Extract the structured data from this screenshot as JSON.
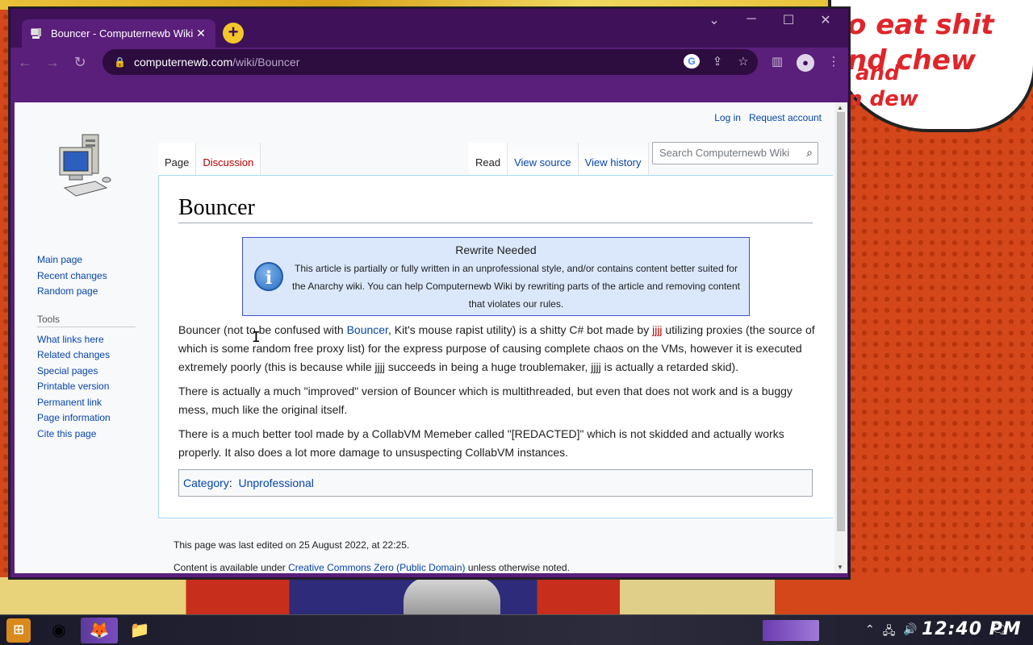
{
  "desktop": {
    "bubble_lines": [
      "o eat shit",
      "nd chew",
      "and",
      "n dew"
    ]
  },
  "browser": {
    "tab_title": "Bouncer - Computernewb Wiki",
    "new_tab_symbol": "+",
    "url_host": "computernewb.com",
    "url_path": "/wiki/Bouncer",
    "accent_color": "#5a1f7a"
  },
  "wiki": {
    "personal": {
      "login": "Log in",
      "request_account": "Request account"
    },
    "nav": [
      "Main page",
      "Recent changes",
      "Random page"
    ],
    "tools_heading": "Tools",
    "tools": [
      "What links here",
      "Related changes",
      "Special pages",
      "Printable version",
      "Permanent link",
      "Page information",
      "Cite this page"
    ],
    "tabs_left": {
      "page": "Page",
      "discussion": "Discussion"
    },
    "tabs_right": {
      "read": "Read",
      "view_source": "View source",
      "view_history": "View history"
    },
    "search_placeholder": "Search Computernewb Wiki",
    "title": "Bouncer",
    "notice": {
      "title": "Rewrite Needed",
      "text": "This article is partially or fully written in an unprofessional style, and/or contains content better suited for the Anarchy wiki. You can help Computernewb Wiki by rewriting parts of the article and removing content that violates our rules."
    },
    "p1": {
      "a": "Bouncer (not to be confused with ",
      "link1": "Bouncer",
      "b": ", Kit's mouse rapist utility) is a shitty C# bot made by ",
      "link2": "jjjj",
      "c": " utilizing proxies (the source of which is some random free proxy list) for the express purpose of causing complete chaos on the VMs, however it is executed extremely poorly (this is because while jjjj succeeds in being a huge troublemaker, jjjj is actually a retarded skid)."
    },
    "p2": "There is actually a much \"improved\" version of Bouncer which is multithreaded, but even that does not work and is a buggy mess, much like the original itself.",
    "p3": "There is a much better tool made by a CollabVM Memeber called \"[REDACTED]\" which is not skidded and actually works properly. It also does a lot more damage to unsuspecting CollabVM instances.",
    "category_label": "Category",
    "category": "Unprofessional",
    "footer": {
      "last_edited": "This page was last edited on 25 August 2022, at 22:25.",
      "license_a": "Content is available under ",
      "license_link": "Creative Commons Zero (Public Domain)",
      "license_b": " unless otherwise noted."
    }
  },
  "taskbar": {
    "clock": "12:40 PM"
  }
}
